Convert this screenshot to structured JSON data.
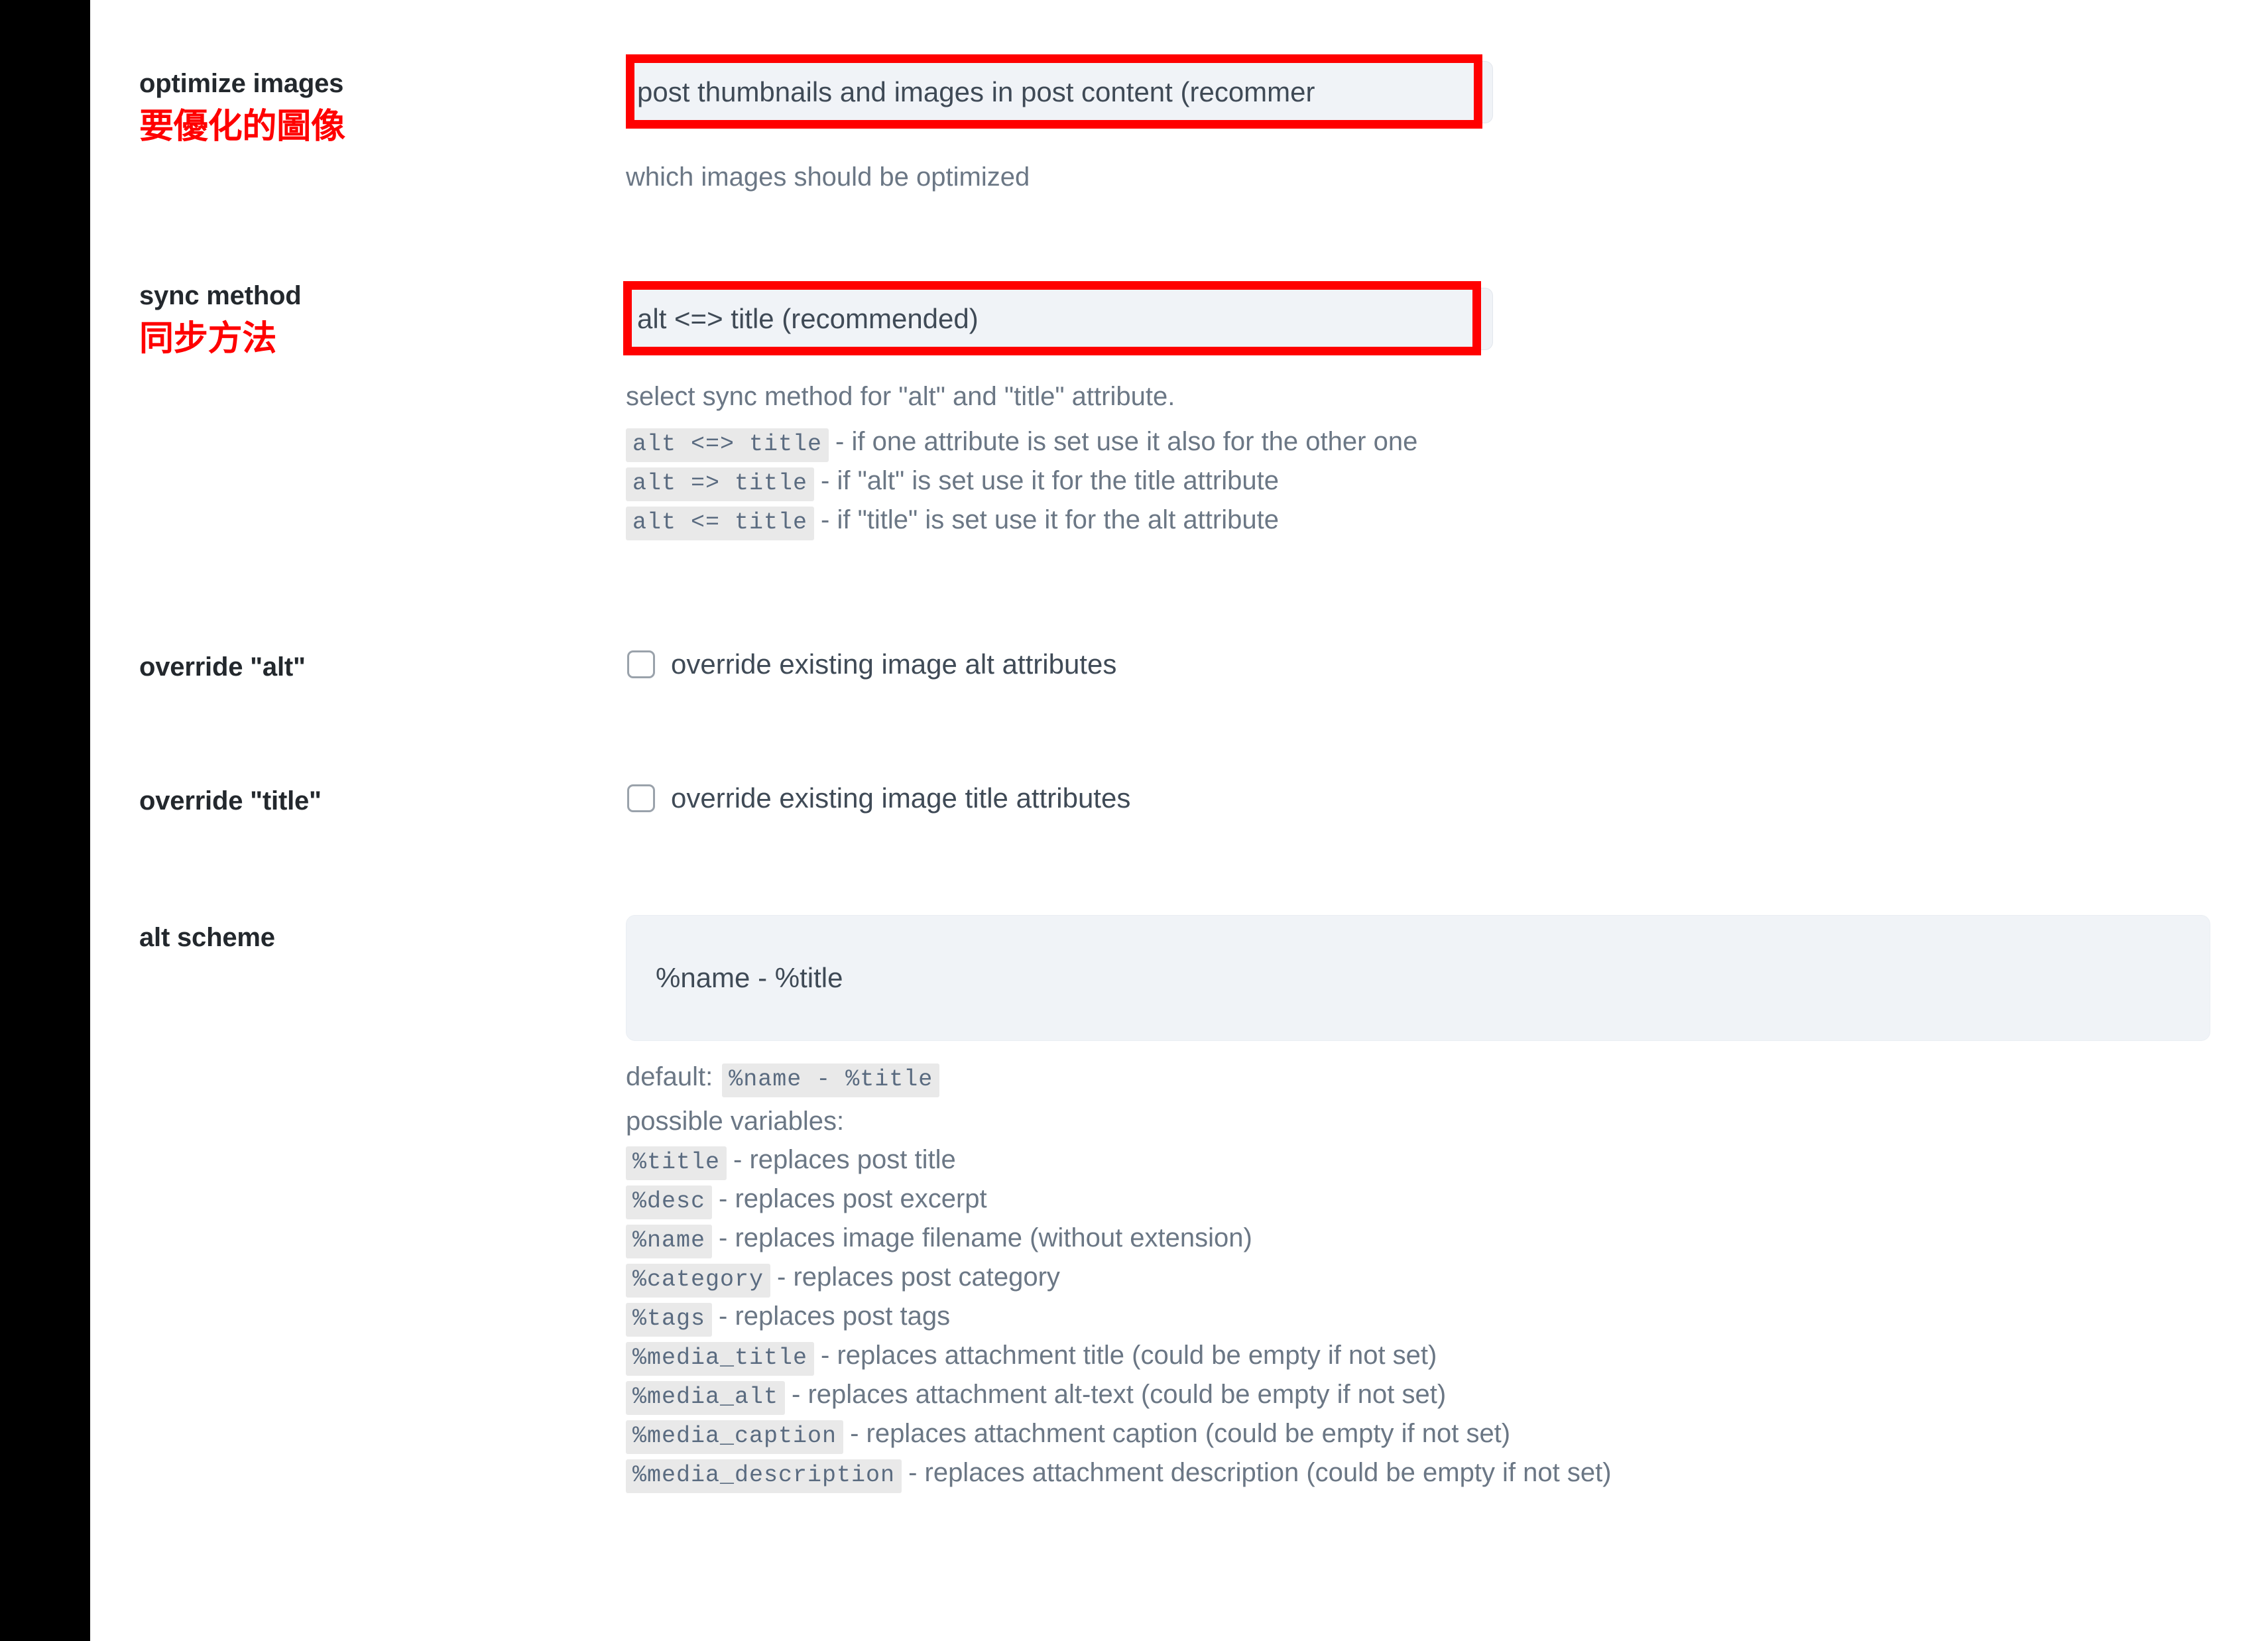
{
  "settings_rows": [
    {
      "label": "optimize images",
      "label_cn": "要優化的圖像",
      "field_value": "post thumbnails and images in post content (recommer",
      "description": "which images should be optimized"
    },
    {
      "label": "sync method",
      "label_cn": "同步方法",
      "field_value": "alt <=> title (recommended)",
      "description": "select sync method for \"alt\" and \"title\" attribute."
    }
  ],
  "sync_method_options": [
    {
      "token": "alt <=> title",
      "desc": "- if one attribute is set use it also for the other one"
    },
    {
      "token": "alt => title",
      "desc": "- if \"alt\" is set use it for the title attribute"
    },
    {
      "token": "alt <= title",
      "desc": "- if \"title\" is set use it for the alt attribute"
    }
  ],
  "override_alt": {
    "label": "override \"alt\"",
    "checkbox_label": "override existing image alt attributes",
    "checked": false
  },
  "override_title": {
    "label": "override \"title\"",
    "checkbox_label": "override existing image title attributes",
    "checked": false
  },
  "alt_scheme": {
    "label": "alt scheme",
    "value": "%name - %title",
    "default_prefix": "default:",
    "default_token": "%name - %title",
    "variables_heading": "possible variables:",
    "variables": [
      {
        "token": "%title",
        "desc": "- replaces post title"
      },
      {
        "token": "%desc",
        "desc": "- replaces post excerpt"
      },
      {
        "token": "%name",
        "desc": "- replaces image filename (without extension)"
      },
      {
        "token": "%category",
        "desc": "- replaces post category"
      },
      {
        "token": "%tags",
        "desc": "- replaces post tags"
      },
      {
        "token": "%media_title",
        "desc": "- replaces attachment title (could be empty if not set)"
      },
      {
        "token": "%media_alt",
        "desc": "- replaces attachment alt-text (could be empty if not set)"
      },
      {
        "token": "%media_caption",
        "desc": "- replaces attachment caption (could be empty if not set)"
      },
      {
        "token": "%media_description",
        "desc": "- replaces attachment description (could be empty if not set)"
      }
    ]
  },
  "colors": {
    "highlight": "#ff0000",
    "field_bg": "#f0f3f7",
    "label": "#23282d",
    "help": "#6b7785",
    "gutter": "#000000"
  }
}
